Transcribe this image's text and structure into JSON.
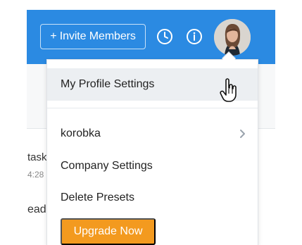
{
  "header": {
    "invite_button_label": "+ Invite Members"
  },
  "icons": {
    "clock": "clock-icon",
    "info": "info-icon",
    "chevron": "chevron-right-icon",
    "cursor": "hand-pointer-icon"
  },
  "under": {
    "task_text": "task",
    "time_text": "4:28",
    "read_text": "ead"
  },
  "menu": {
    "items": [
      {
        "label": "My Profile Settings"
      },
      {
        "label": "korobka"
      },
      {
        "label": "Company Settings"
      },
      {
        "label": "Delete Presets"
      }
    ],
    "upgrade_label": "Upgrade Now"
  },
  "colors": {
    "brand_blue": "#2b8ae2",
    "upgrade_orange": "#f39a1f",
    "hover_gray": "#eceff2"
  }
}
